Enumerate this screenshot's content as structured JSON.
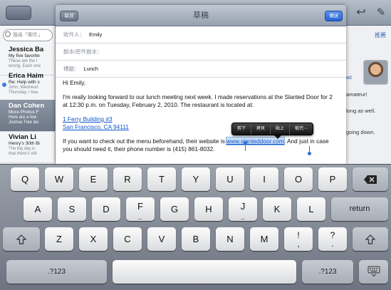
{
  "background": {
    "search_placeholder": "搜尋「郵件」",
    "mail_list": [
      {
        "from": "Jessica Ba",
        "subject": "My five favorite",
        "preview": "These are the l",
        "preview2": "wrong. Each one",
        "unread": false,
        "selected": false
      },
      {
        "from": "Erica Haim",
        "subject": "Re: Help with s",
        "preview": "John, Wednesd",
        "preview2": "Thursday, I hea",
        "unread": true,
        "selected": false
      },
      {
        "from": "Dan Cohen",
        "subject": "More Photos F",
        "preview": "Here are a few",
        "preview2": "Joshua Tree las",
        "unread": false,
        "selected": true
      },
      {
        "from": "Vivian Li",
        "subject": "Henry's 30th Bi",
        "preview": "The big day is",
        "preview2": "that there's still",
        "unread": false,
        "selected": false
      }
    ],
    "right_link": "推薦",
    "right_name": "ad",
    "right_lines": [
      "amateur!",
      "long as well.",
      "going down."
    ]
  },
  "compose": {
    "cancel_label": "取消",
    "title": "草稿",
    "send_label": "傳送",
    "to_label": "收件人：",
    "to_value": "Emily",
    "cc_label": "副本/密件副本：",
    "subject_label": "標題：",
    "subject_value": "Lunch",
    "greeting": "Hi Emily,",
    "paragraph1": "I'm really looking forward to our lunch meeting next week. I made reservations at the Slanted Door for 2 at 12:30 p.m. on Tuesday, February 2, 2010. The restaurant is located at:",
    "address_line1": "1 Ferry Building #3",
    "address_line2": "San Francisco, CA 94111",
    "paragraph2_before": "If you want to check out the menu beforehand, their website is ",
    "paragraph2_link": "www.slanteddoor.com",
    "paragraph2_after": ". And just in case you should need it, their phone number is (415) 861-8032."
  },
  "edit_menu": [
    "剪下",
    "拷貝",
    "貼上",
    "取代⋯"
  ],
  "keyboard": {
    "row1": [
      "Q",
      "W",
      "E",
      "R",
      "T",
      "Y",
      "U",
      "I",
      "O",
      "P"
    ],
    "row2": [
      "A",
      "S",
      "D",
      "F",
      "G",
      "H",
      "J",
      "K",
      "L"
    ],
    "row2_subs": {
      "F": "_",
      "J": "_"
    },
    "return_label": "return",
    "row3": [
      "Z",
      "X",
      "C",
      "V",
      "B",
      "N",
      "M"
    ],
    "row3_dual": [
      {
        "top": "!",
        "bottom": ","
      },
      {
        "top": "?",
        "bottom": "."
      }
    ],
    "numbers_label": ".?123"
  }
}
